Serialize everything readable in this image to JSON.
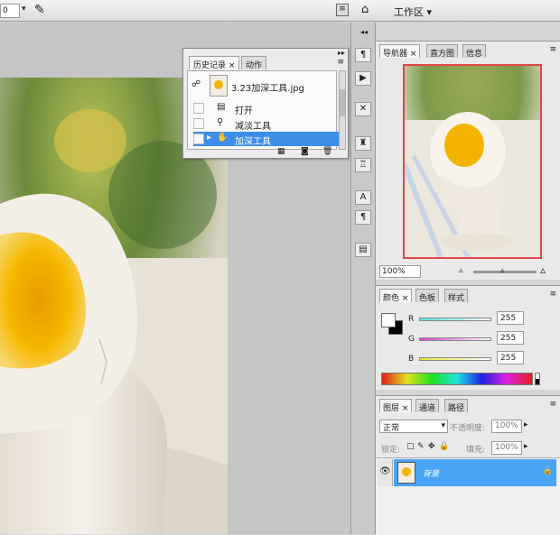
{
  "topbar": {
    "zoom_fragment": "0",
    "workspace_label": "工作区"
  },
  "history": {
    "tabs": [
      "历史记录",
      "动作"
    ],
    "snapshot_name": "3.23加深工具.jpg",
    "items": [
      "打开",
      "减淡工具",
      "加深工具"
    ],
    "selected_index": 2
  },
  "navigator": {
    "tabs": [
      "导航器",
      "直方图",
      "信息"
    ],
    "zoom": "100%"
  },
  "color_panel": {
    "tabs": [
      "颜色",
      "色板",
      "样式"
    ],
    "channels": [
      {
        "label": "R",
        "value": "255"
      },
      {
        "label": "G",
        "value": "255"
      },
      {
        "label": "B",
        "value": "255"
      }
    ]
  },
  "layers": {
    "tabs": [
      "图层",
      "通道",
      "路径"
    ],
    "blend_mode": "正常",
    "opacity_label": "不透明度:",
    "opacity_value": "100%",
    "lock_label": "锁定:",
    "fill_label": "填充:",
    "fill_value": "100%",
    "layer_name": "背景"
  },
  "colors": {
    "accent": "#3d8ee8",
    "layer_highlight": "#4aa4f5",
    "yolk": "#f0b400"
  }
}
